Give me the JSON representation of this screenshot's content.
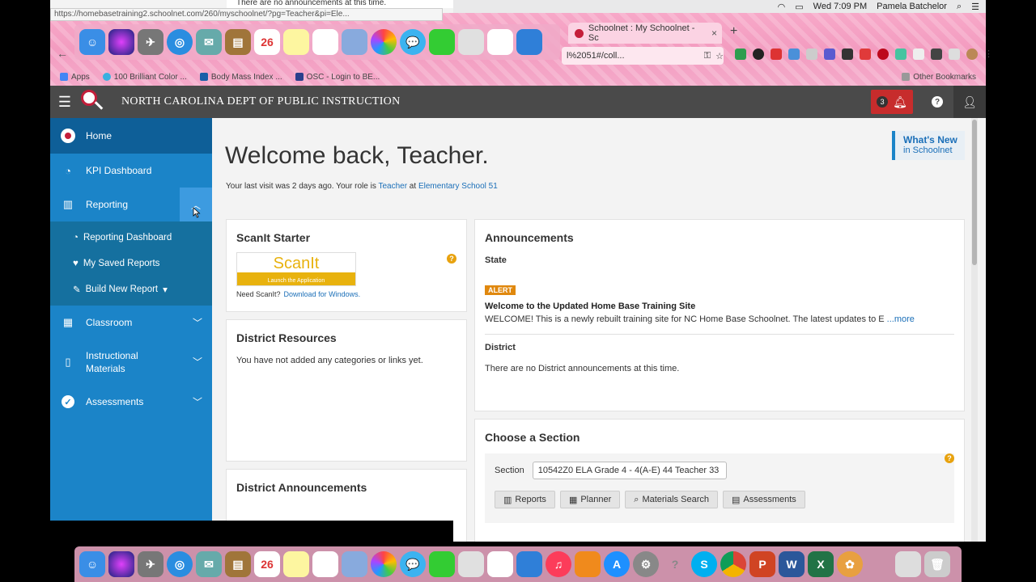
{
  "system": {
    "time": "Wed 7:09 PM",
    "user": "Pamela Batchelor"
  },
  "tooltip": {
    "url": "https://homebasetraining2.schoolnet.com/260/myschoolnet/?pg=Teacher&pi=Ele...",
    "notice": "There are no announcements at this time."
  },
  "browser": {
    "tab_title": "Schoolnet : My Schoolnet - Sc",
    "tab_close": "×",
    "new_tab": "+",
    "address": "l%2051#/coll...",
    "bookmarks": [
      {
        "label": "Apps"
      },
      {
        "label": "100 Brilliant Color ..."
      },
      {
        "label": "Body Mass Index ..."
      },
      {
        "label": "OSC - Login to BE..."
      }
    ],
    "other_bookmarks": "Other Bookmarks"
  },
  "header": {
    "org_title": "NORTH CAROLINA DEPT OF PUBLIC INSTRUCTION",
    "notification_count": "3",
    "help_label": "?"
  },
  "sidebar": {
    "items": [
      {
        "label": "Home"
      },
      {
        "label": "KPI Dashboard"
      },
      {
        "label": "Reporting"
      },
      {
        "label": "Classroom"
      },
      {
        "label": "Instructional Materials"
      },
      {
        "label": "Assessments"
      }
    ],
    "reporting_sub": [
      {
        "label": "Reporting Dashboard"
      },
      {
        "label": "My Saved Reports"
      },
      {
        "label": "Build New Report"
      }
    ]
  },
  "main": {
    "welcome": "Welcome back, Teacher.",
    "last_visit_prefix": "Your last visit was 2 days ago. Your role is ",
    "role": "Teacher",
    "at": " at ",
    "school": "Elementary School 51",
    "whats_new_1": "What's New",
    "whats_new_2": "in Schoolnet",
    "scanit": {
      "title": "ScanIt Starter",
      "logo_word": "ScanIt",
      "logo_launch": "Launch the Application",
      "need": "Need ScanIt?",
      "download": "Download for Windows."
    },
    "district_resources": {
      "title": "District Resources",
      "text": "You have not added any categories or links yet."
    },
    "district_announcements": {
      "title": "District Announcements"
    },
    "announcements": {
      "title": "Announcements",
      "state": "State",
      "alert": "ALERT",
      "headline": "Welcome to the Updated Home Base Training Site",
      "body": "WELCOME! This is a newly rebuilt training site for NC Home Base Schoolnet. The latest updates to E ",
      "more": "...more",
      "district": "District",
      "district_none": "There are no District announcements at this time."
    },
    "choose_section": {
      "title": "Choose a Section",
      "section_label": "Section",
      "section_value": "10542Z0 ELA Grade 4 - 4(A-E) 44 Teacher 33",
      "buttons": [
        {
          "label": "Reports"
        },
        {
          "label": "Planner"
        },
        {
          "label": "Materials Search"
        },
        {
          "label": "Assessments"
        }
      ]
    }
  },
  "colors": {
    "sidebar": "#1b84c8",
    "header": "#4a4a4a",
    "accent_red": "#c72c2c",
    "alert": "#e0880e"
  }
}
